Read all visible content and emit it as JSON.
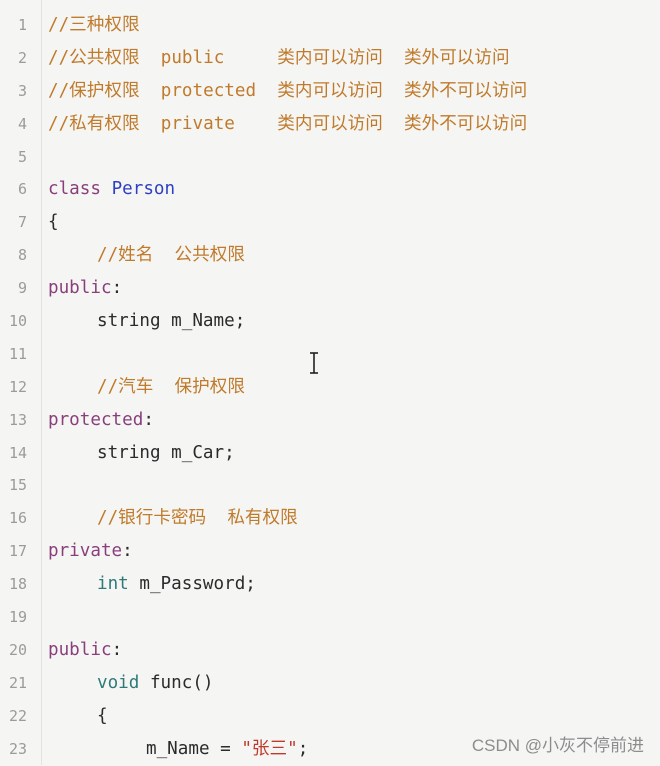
{
  "editor": {
    "lines": [
      {
        "n": "1",
        "parts": [
          {
            "t": "//三种权限",
            "c": "cmt"
          }
        ]
      },
      {
        "n": "2",
        "parts": [
          {
            "t": "//公共权限  public     类内可以访问  类外可以访问",
            "c": "cmt"
          }
        ]
      },
      {
        "n": "3",
        "parts": [
          {
            "t": "//保护权限  protected  类内可以访问  类外不可以访问",
            "c": "cmt"
          }
        ]
      },
      {
        "n": "4",
        "parts": [
          {
            "t": "//私有权限  private    类内可以访问  类外不可以访问",
            "c": "cmt"
          }
        ]
      },
      {
        "n": "5",
        "parts": []
      },
      {
        "n": "6",
        "parts": [
          {
            "t": "class ",
            "c": "kw"
          },
          {
            "t": "Person",
            "c": "cls"
          }
        ]
      },
      {
        "n": "7",
        "parts": [
          {
            "t": "{",
            "c": "plain"
          }
        ]
      },
      {
        "n": "8",
        "indent": 1,
        "parts": [
          {
            "t": "//姓名  公共权限",
            "c": "cmt"
          }
        ]
      },
      {
        "n": "9",
        "parts": [
          {
            "t": "public",
            "c": "kw"
          },
          {
            "t": ":",
            "c": "plain"
          }
        ]
      },
      {
        "n": "10",
        "indent": 1,
        "parts": [
          {
            "t": "string m_Name;",
            "c": "plain"
          }
        ]
      },
      {
        "n": "11",
        "parts": []
      },
      {
        "n": "12",
        "indent": 1,
        "parts": [
          {
            "t": "//汽车  保护权限",
            "c": "cmt"
          }
        ]
      },
      {
        "n": "13",
        "parts": [
          {
            "t": "protected",
            "c": "kw"
          },
          {
            "t": ":",
            "c": "plain"
          }
        ]
      },
      {
        "n": "14",
        "indent": 1,
        "parts": [
          {
            "t": "string m_Car;",
            "c": "plain"
          }
        ]
      },
      {
        "n": "15",
        "parts": []
      },
      {
        "n": "16",
        "indent": 1,
        "parts": [
          {
            "t": "//银行卡密码  私有权限",
            "c": "cmt"
          }
        ]
      },
      {
        "n": "17",
        "parts": [
          {
            "t": "private",
            "c": "kw"
          },
          {
            "t": ":",
            "c": "plain"
          }
        ]
      },
      {
        "n": "18",
        "indent": 1,
        "parts": [
          {
            "t": "int ",
            "c": "type"
          },
          {
            "t": "m_Password;",
            "c": "plain"
          }
        ]
      },
      {
        "n": "19",
        "parts": []
      },
      {
        "n": "20",
        "parts": [
          {
            "t": "public",
            "c": "kw"
          },
          {
            "t": ":",
            "c": "plain"
          }
        ]
      },
      {
        "n": "21",
        "indent": 1,
        "parts": [
          {
            "t": "void ",
            "c": "type"
          },
          {
            "t": "func()",
            "c": "plain"
          }
        ]
      },
      {
        "n": "22",
        "indent": 1,
        "parts": [
          {
            "t": "{",
            "c": "plain"
          }
        ]
      },
      {
        "n": "23",
        "indent": 2,
        "parts": [
          {
            "t": "m_Name = ",
            "c": "plain"
          },
          {
            "t": "\"张三\"",
            "c": "str"
          },
          {
            "t": ";",
            "c": "plain"
          }
        ]
      }
    ]
  },
  "cursor": {
    "icon": "text-cursor-icon"
  },
  "watermark": "CSDN @小灰不停前进"
}
